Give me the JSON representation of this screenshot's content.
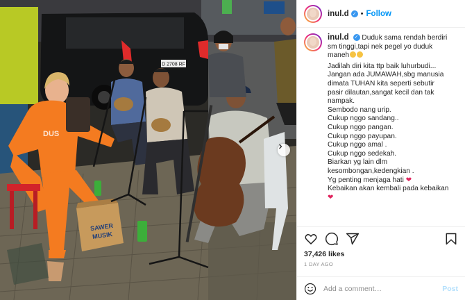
{
  "account": {
    "username": "inul.d",
    "follow_label": "Follow",
    "separator": "•"
  },
  "photo": {
    "car_plate": "D 2708 RF",
    "box_label_line1": "SAWER",
    "box_label_line2": "MUSIK"
  },
  "caption": {
    "lines": [
      "Duduk sama rendah berdiri",
      "sm tinggi,tapi nek pegel yo duduk",
      "maneh",
      "Jadilah diri kita ttp baik luhurbudi...",
      "Jangan ada JUMAWAH,sbg manusia",
      "dimata TUHAN kita seperti sebutir",
      "pasir dilautan,sangat kecil dan tak",
      "nampak.",
      "Sembodo nang urip.",
      "Cukup nggo sandang..",
      "Cukup nggo pangan.",
      "Cukup nggo payupan.",
      "Cukup nggo amal .",
      "Cukup nggo sedekah.",
      "Biarkan yg lain dlm",
      "kesombongan,kedengkian .",
      "Yg penting menjaga hati",
      "Kebaikan akan kembali pada kebaikan"
    ]
  },
  "actions": {
    "icons": [
      "heart-icon",
      "comment-icon",
      "share-icon",
      "bookmark-icon"
    ]
  },
  "likes_text": "37,426 likes",
  "time_text": "1 DAY AGO",
  "comment_box": {
    "placeholder": "Add a comment…",
    "post_label": "Post"
  },
  "colors": {
    "accent": "#0095f6",
    "post_disabled": "#b2dffc",
    "verified": "#3897f0",
    "heart_emoji": "#e0245e"
  }
}
